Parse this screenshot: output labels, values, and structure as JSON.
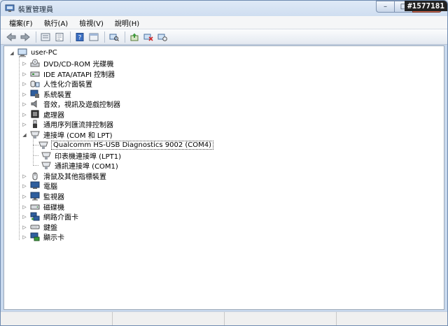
{
  "window": {
    "title": "裝置管理員",
    "watermark": "#1577181"
  },
  "caption": {
    "minimize": "–",
    "maximize": "□",
    "close": "✕"
  },
  "menubar": {
    "items": [
      {
        "label": "檔案(F)"
      },
      {
        "label": "執行(A)"
      },
      {
        "label": "檢視(V)"
      },
      {
        "label": "說明(H)"
      }
    ]
  },
  "toolbar": {
    "icons": [
      "back-arrow-icon",
      "forward-arrow-icon",
      "properties-icon",
      "help-page-icon",
      "help-icon",
      "show-view-icon",
      "scan-hardware-icon",
      "update-driver-icon",
      "disable-device-icon",
      "uninstall-device-icon"
    ]
  },
  "tree": {
    "root": {
      "label": "user-PC",
      "icon": "computer-icon"
    },
    "categories": [
      {
        "label": "DVD/CD-ROM 光碟機",
        "icon": "dvd-drive-icon",
        "expanded": false
      },
      {
        "label": "IDE ATA/ATAPI 控制器",
        "icon": "ide-controller-icon",
        "expanded": false
      },
      {
        "label": "人性化介面裝置",
        "icon": "hid-icon",
        "expanded": false
      },
      {
        "label": "系統裝置",
        "icon": "system-devices-icon",
        "expanded": false
      },
      {
        "label": "音效，視訊及遊戲控制器",
        "icon": "sound-icon",
        "expanded": false
      },
      {
        "label": "處理器",
        "icon": "processor-icon",
        "expanded": false
      },
      {
        "label": "通用序列匯流排控制器",
        "icon": "usb-icon",
        "expanded": false
      },
      {
        "label": "連接埠 (COM 和 LPT)",
        "icon": "port-icon",
        "expanded": true,
        "children": [
          {
            "label": "Qualcomm HS-USB Diagnostics 9002 (COM4)",
            "icon": "port-icon",
            "selected": true
          },
          {
            "label": "印表機連接埠 (LPT1)",
            "icon": "port-icon",
            "selected": false
          },
          {
            "label": "通訊連接埠 (COM1)",
            "icon": "port-icon",
            "selected": false
          }
        ]
      },
      {
        "label": "滑鼠及其他指標裝置",
        "icon": "mouse-icon",
        "expanded": false
      },
      {
        "label": "電腦",
        "icon": "computer-icon",
        "expanded": false
      },
      {
        "label": "監視器",
        "icon": "monitor-icon",
        "expanded": false
      },
      {
        "label": "磁碟機",
        "icon": "disk-drive-icon",
        "expanded": false
      },
      {
        "label": "網路介面卡",
        "icon": "network-adapter-icon",
        "expanded": false
      },
      {
        "label": "鍵盤",
        "icon": "keyboard-icon",
        "expanded": false
      },
      {
        "label": "顯示卡",
        "icon": "display-adapter-icon",
        "expanded": false
      }
    ]
  }
}
